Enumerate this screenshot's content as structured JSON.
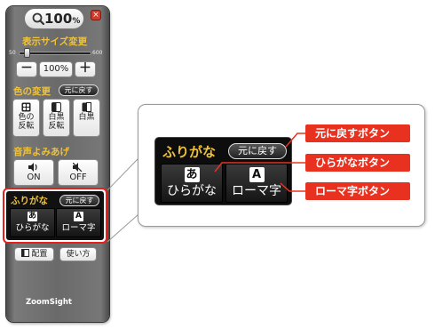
{
  "toolbar": {
    "zoom_value": "100",
    "zoom_unit": "%",
    "close_icon": "×",
    "size_section_label": "表示サイズ変更",
    "slider_min": "50",
    "slider_max": "600",
    "slider_level": 0.03,
    "minus_label": "－",
    "percent_label": "100%",
    "plus_label": "＋",
    "color_section_label": "色の変更",
    "color_reset_label": "元に戻す",
    "color_buttons": [
      {
        "line1": "色の",
        "line2": "反転",
        "icon": "color-invert-icon"
      },
      {
        "line1": "白黒",
        "line2": "反転",
        "icon": "bw-invert-icon"
      },
      {
        "line1": "白黒",
        "line2": "",
        "icon": "bw-icon"
      }
    ],
    "voice_section_label": "音声よみあげ",
    "voice_on": "ON",
    "voice_off": "OFF",
    "furigana_label": "ふりがな",
    "furigana_reset_label": "元に戻す",
    "hiragana_glyph": "あ",
    "hiragana_label": "ひらがな",
    "roman_glyph": "A",
    "roman_label": "ローマ字",
    "layout_label": "配置",
    "help_label": "使い方",
    "logo_text": "ZoomSight"
  },
  "callout": {
    "furigana_label": "ふりがな",
    "reset_label": "元に戻す",
    "hiragana_glyph": "あ",
    "hiragana_label": "ひらがな",
    "roman_glyph": "A",
    "roman_label": "ローマ字",
    "annotations": [
      "元に戻すボタン",
      "ひらがなボタン",
      "ローマ字ボタン"
    ]
  },
  "colors": {
    "accent_red": "#e8311f",
    "label_gold": "#f0c238"
  }
}
